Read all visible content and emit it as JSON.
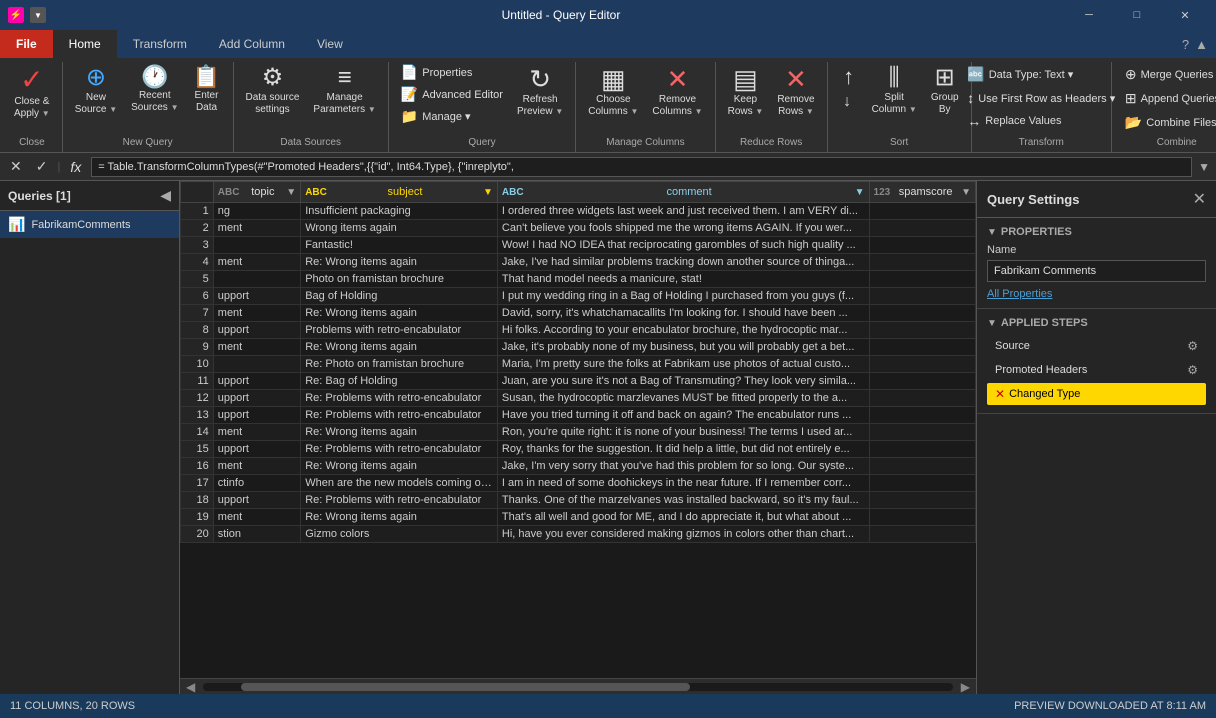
{
  "titleBar": {
    "appName": "Untitled - Query Editor",
    "icons": [
      "power-bi-icon",
      "settings-icon",
      "emoji-icon"
    ],
    "controls": [
      "minimize",
      "maximize",
      "close"
    ]
  },
  "ribbonTabs": [
    {
      "id": "file",
      "label": "File",
      "isFile": true
    },
    {
      "id": "home",
      "label": "Home",
      "active": true
    },
    {
      "id": "transform",
      "label": "Transform"
    },
    {
      "id": "addColumn",
      "label": "Add Column"
    },
    {
      "id": "view",
      "label": "View"
    }
  ],
  "ribbonGroups": {
    "close": {
      "label": "Close",
      "buttons": [
        {
          "label": "Close &\nApply",
          "icon": "✓",
          "hasDropdown": true
        }
      ]
    },
    "newQuery": {
      "label": "New Query",
      "buttons": [
        {
          "label": "New\nSource",
          "icon": "⊕",
          "hasDropdown": true
        },
        {
          "label": "Recent\nSources",
          "icon": "🕐",
          "hasDropdown": true
        },
        {
          "label": "Enter\nData",
          "icon": "📋"
        }
      ]
    },
    "dataSources": {
      "label": "Data Sources",
      "buttons": [
        {
          "label": "Data source\nsettings",
          "icon": "⚙"
        },
        {
          "label": "Manage\nParameters",
          "icon": "≡",
          "hasDropdown": true
        }
      ]
    },
    "query": {
      "label": "Query",
      "buttons": [
        {
          "label": "Properties",
          "icon": "📄"
        },
        {
          "label": "Advanced Editor",
          "icon": "📝"
        },
        {
          "label": "Refresh\nPreview",
          "icon": "↻",
          "hasDropdown": true
        },
        {
          "label": "Manage ▾",
          "icon": "📁"
        }
      ]
    },
    "manageColumns": {
      "label": "Manage Columns",
      "buttons": [
        {
          "label": "Choose\nColumns",
          "icon": "▦",
          "hasDropdown": true
        },
        {
          "label": "Remove\nColumns",
          "icon": "✕",
          "hasDropdown": true
        }
      ]
    },
    "reduceRows": {
      "label": "Reduce Rows",
      "buttons": [
        {
          "label": "Keep\nRows",
          "icon": "▤",
          "hasDropdown": true
        },
        {
          "label": "Remove\nRows",
          "icon": "✕",
          "hasDropdown": true
        }
      ]
    },
    "sort": {
      "label": "Sort",
      "buttons": [
        {
          "label": "↑",
          "icon": "↑"
        },
        {
          "label": "↓",
          "icon": "↓"
        }
      ]
    },
    "transform": {
      "label": "Transform",
      "rightItems": [
        {
          "label": "Data Type: Text ▾"
        },
        {
          "label": "Use First Row as Headers ▾"
        },
        {
          "label": "Replace Values"
        }
      ]
    },
    "combine": {
      "label": "Combine",
      "rightItems": [
        {
          "label": "Merge Queries ▾"
        },
        {
          "label": "Append Queries ▾"
        },
        {
          "label": "Combine Files"
        }
      ]
    }
  },
  "formulaBar": {
    "cancelIcon": "✕",
    "confirmIcon": "✓",
    "fxIcon": "fx",
    "formula": "= Table.TransformColumnTypes(#\"Promoted Headers\",{{\"id\", Int64.Type}, {\"inreplyto\","
  },
  "queriesPanel": {
    "title": "Queries [1]",
    "collapseIcon": "◀",
    "queries": [
      {
        "name": "FabrikamComments",
        "icon": "📊",
        "selected": true
      }
    ]
  },
  "gridColumns": [
    {
      "id": "topic",
      "type": "ABC",
      "name": "topic",
      "highlight": false
    },
    {
      "id": "subject",
      "type": "ABC",
      "name": "subject",
      "highlight": true
    },
    {
      "id": "comment",
      "type": "ABC",
      "name": "comment",
      "highlight": true,
      "commentStyle": true
    },
    {
      "id": "spamscore",
      "type": "123",
      "name": "spamscore",
      "highlight": false
    }
  ],
  "gridRows": [
    {
      "num": 1,
      "topic": "ng",
      "subject": "Insufficient packaging",
      "comment": "I ordered three widgets last week and just received them. I am VERY di...",
      "spamscore": ""
    },
    {
      "num": 2,
      "topic": "ment",
      "subject": "Wrong items again",
      "comment": "Can't believe you fools shipped me the wrong items AGAIN. If you wer...",
      "spamscore": ""
    },
    {
      "num": 3,
      "topic": "",
      "subject": "Fantastic!",
      "comment": "Wow! I had NO IDEA that reciprocating garombles of such high quality ...",
      "spamscore": ""
    },
    {
      "num": 4,
      "topic": "ment",
      "subject": "Re: Wrong items again",
      "comment": "Jake, I've had similar problems tracking down another source of thinga...",
      "spamscore": ""
    },
    {
      "num": 5,
      "topic": "",
      "subject": "Photo on framistan brochure",
      "comment": "That hand model needs a manicure, stat!",
      "spamscore": ""
    },
    {
      "num": 6,
      "topic": "upport",
      "subject": "Bag of Holding",
      "comment": "I put my wedding ring in a Bag of Holding I purchased from you guys (f...",
      "spamscore": ""
    },
    {
      "num": 7,
      "topic": "ment",
      "subject": "Re: Wrong items again",
      "comment": "David, sorry, it's whatchamacallits I'm looking for. I should have been ...",
      "spamscore": ""
    },
    {
      "num": 8,
      "topic": "upport",
      "subject": "Problems with retro-encabulator",
      "comment": "Hi folks. According to your encabulator brochure, the hydrocoptic mar...",
      "spamscore": ""
    },
    {
      "num": 9,
      "topic": "ment",
      "subject": "Re: Wrong items again",
      "comment": "Jake, it's probably none of my business, but you will probably get a bet...",
      "spamscore": ""
    },
    {
      "num": 10,
      "topic": "",
      "subject": "Re: Photo on framistan brochure",
      "comment": "Maria, I'm pretty sure the folks at Fabrikam use photos of actual custo...",
      "spamscore": ""
    },
    {
      "num": 11,
      "topic": "upport",
      "subject": "Re: Bag of Holding",
      "comment": "Juan, are you sure it's not a Bag of Transmuting? They look very simila...",
      "spamscore": ""
    },
    {
      "num": 12,
      "topic": "upport",
      "subject": "Re: Problems with retro-encabulator",
      "comment": "Susan, the hydrocoptic marzlevanes MUST be fitted properly to the a...",
      "spamscore": ""
    },
    {
      "num": 13,
      "topic": "upport",
      "subject": "Re: Problems with retro-encabulator",
      "comment": "Have you tried turning it off and back on again? The encabulator runs ...",
      "spamscore": ""
    },
    {
      "num": 14,
      "topic": "ment",
      "subject": "Re: Wrong items again",
      "comment": "Ron, you're quite right: it is none of your business! The terms I used ar...",
      "spamscore": ""
    },
    {
      "num": 15,
      "topic": "upport",
      "subject": "Re: Problems with retro-encabulator",
      "comment": "Roy, thanks for the suggestion. It did help a little, but did not entirely e...",
      "spamscore": ""
    },
    {
      "num": 16,
      "topic": "ment",
      "subject": "Re: Wrong items again",
      "comment": "Jake, I'm very sorry that you've had this problem for so long. Our syste...",
      "spamscore": ""
    },
    {
      "num": 17,
      "topic": "ctinfo",
      "subject": "When are the new models coming out?",
      "comment": "I am in need of some doohickeys in the near future. If I remember corr...",
      "spamscore": ""
    },
    {
      "num": 18,
      "topic": "upport",
      "subject": "Re: Problems with retro-encabulator",
      "comment": "Thanks. One of the marzelvanes was installed backward, so it's my faul...",
      "spamscore": ""
    },
    {
      "num": 19,
      "topic": "ment",
      "subject": "Re: Wrong items again",
      "comment": "That's all well and good for ME, and I do appreciate it, but what about ...",
      "spamscore": ""
    },
    {
      "num": 20,
      "topic": "stion",
      "subject": "Gizmo colors",
      "comment": "Hi, have you ever considered making gizmos in colors other than chart...",
      "spamscore": ""
    }
  ],
  "querySettings": {
    "title": "Query Settings",
    "closeIcon": "✕",
    "propertiesSection": {
      "title": "PROPERTIES",
      "nameLabel": "Name",
      "nameValue": "Fabrikam Comments",
      "allPropertiesLink": "All Properties"
    },
    "stepsSection": {
      "title": "APPLIED STEPS",
      "steps": [
        {
          "name": "Source",
          "hasGear": true,
          "active": false,
          "hasError": false
        },
        {
          "name": "Promoted Headers",
          "hasGear": true,
          "active": false,
          "hasError": false
        },
        {
          "name": "Changed Type",
          "hasGear": false,
          "active": true,
          "hasError": true
        }
      ]
    }
  },
  "statusBar": {
    "leftText": "11 COLUMNS, 20 ROWS",
    "rightText": "PREVIEW DOWNLOADED AT 8:11 AM"
  }
}
